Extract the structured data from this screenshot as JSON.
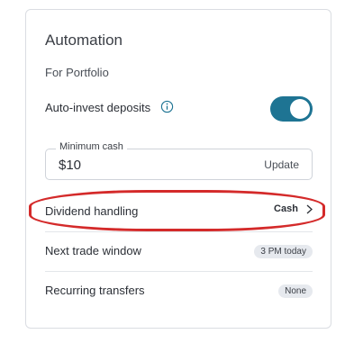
{
  "card": {
    "title": "Automation",
    "subtitle": "For Portfolio"
  },
  "auto_invest": {
    "label": "Auto-invest deposits",
    "enabled": true,
    "info_icon": "info-icon",
    "accent": "#1e7493"
  },
  "minimum_cash": {
    "legend": "Minimum cash",
    "value": "$10",
    "action": "Update"
  },
  "dividend": {
    "label": "Dividend handling",
    "value": "Cash",
    "chevron_icon": "chevron-right-icon"
  },
  "next_trade": {
    "label": "Next trade window",
    "badge": "3 PM today"
  },
  "recurring": {
    "label": "Recurring transfers",
    "badge": "None"
  },
  "annotation": {
    "color": "#d42a2a"
  }
}
